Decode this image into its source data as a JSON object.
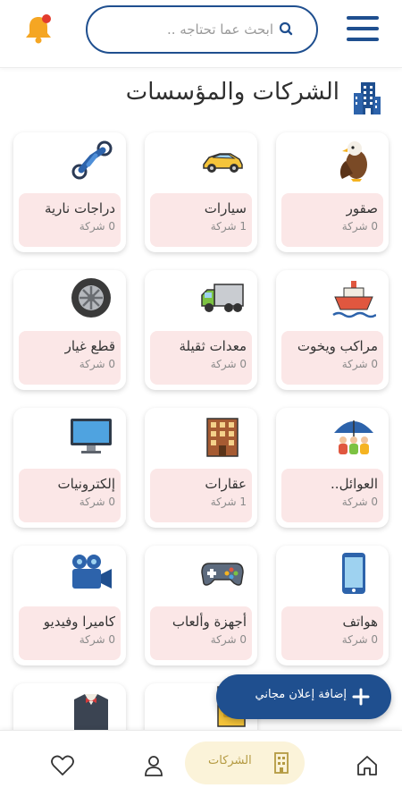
{
  "header": {
    "search_placeholder": "ابحث عما تحتاجه ..",
    "accent_color": "#1f4f8f"
  },
  "page": {
    "title": "الشركات والمؤسسات"
  },
  "categories": [
    {
      "name": "صقور",
      "count": "0 شركة",
      "icon": "falcon-icon"
    },
    {
      "name": "سيارات",
      "count": "1 شركة",
      "icon": "car-icon"
    },
    {
      "name": "دراجات نارية",
      "count": "0 شركة",
      "icon": "motorcycle-icon"
    },
    {
      "name": "مراكب ويخوت",
      "count": "0 شركة",
      "icon": "ship-icon"
    },
    {
      "name": "معدات ثقيلة",
      "count": "0 شركة",
      "icon": "truck-icon"
    },
    {
      "name": "قطع غيار",
      "count": "0 شركة",
      "icon": "tire-icon"
    },
    {
      "name": "العوائل..",
      "count": "0 شركة",
      "icon": "family-umbrella-icon"
    },
    {
      "name": "عقارات",
      "count": "1 شركة",
      "icon": "building-icon"
    },
    {
      "name": "إلكترونيات",
      "count": "0 شركة",
      "icon": "monitor-icon"
    },
    {
      "name": "هواتف",
      "count": "0 شركة",
      "icon": "phone-icon"
    },
    {
      "name": "أجهزة وألعاب",
      "count": "0 شركة",
      "icon": "gamepad-icon"
    },
    {
      "name": "كاميرا وفيديو",
      "count": "0 شركة",
      "icon": "video-camera-icon"
    }
  ],
  "fab": {
    "label": "إضافة إعلان مجاني"
  },
  "bottom_nav": {
    "active_label": "الشركات",
    "active_color": "#b49a42"
  }
}
